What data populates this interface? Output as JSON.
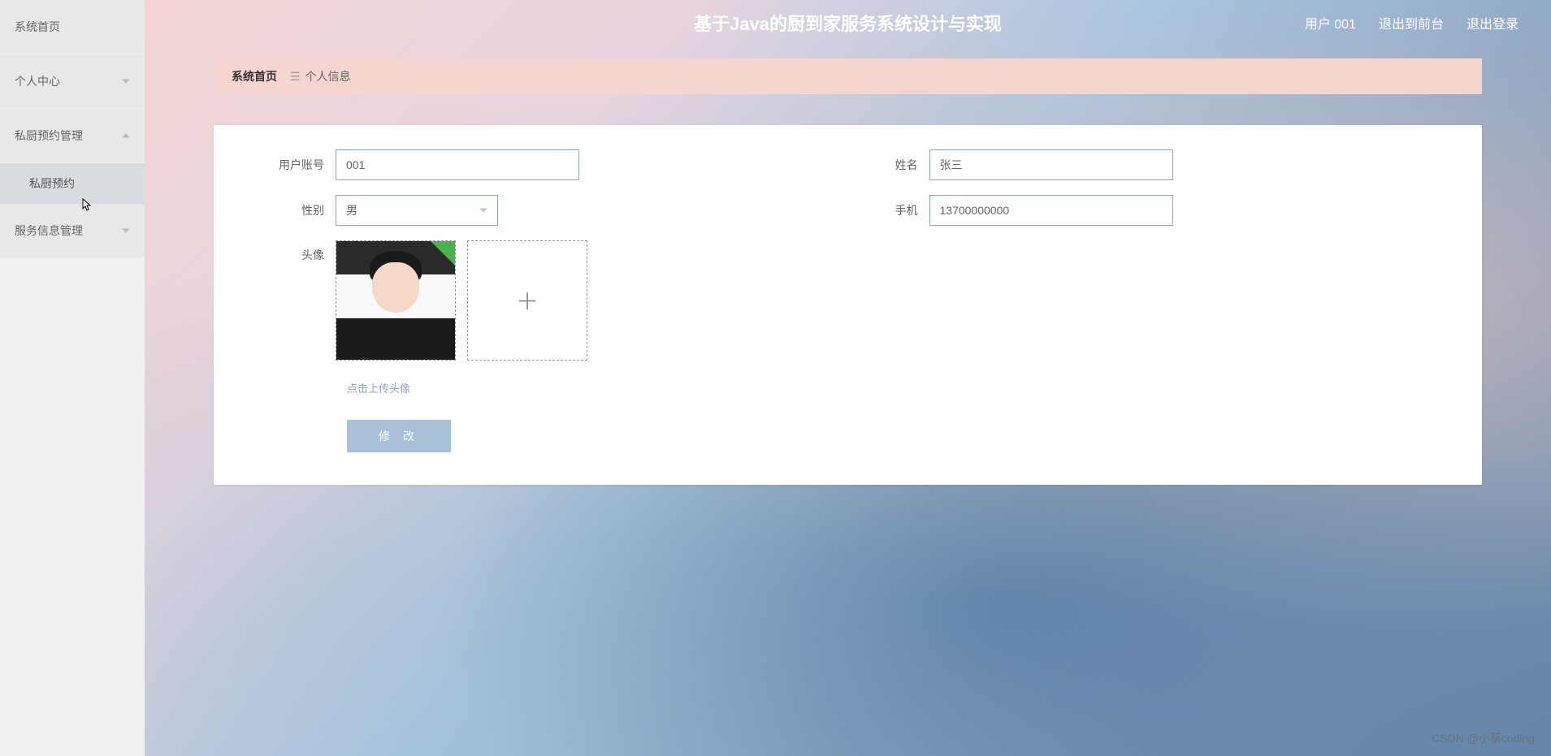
{
  "header": {
    "title": "基于Java的厨到家服务系统设计与实现",
    "links": {
      "user": "用户 001",
      "logout_front": "退出到前台",
      "logout": "退出登录"
    }
  },
  "sidebar": {
    "items": [
      {
        "label": "系统首页",
        "expandable": false
      },
      {
        "label": "个人中心",
        "expandable": true,
        "expanded": false
      },
      {
        "label": "私厨预约管理",
        "expandable": true,
        "expanded": true,
        "children": [
          {
            "label": "私厨预约"
          }
        ]
      },
      {
        "label": "服务信息管理",
        "expandable": true,
        "expanded": false
      }
    ]
  },
  "breadcrumb": {
    "home": "系统首页",
    "current": "个人信息"
  },
  "form": {
    "account": {
      "label": "用户账号",
      "value": "001"
    },
    "name": {
      "label": "姓名",
      "value": "张三"
    },
    "gender": {
      "label": "性别",
      "value": "男"
    },
    "phone": {
      "label": "手机",
      "value": "13700000000"
    },
    "avatar": {
      "label": "头像"
    },
    "upload_hint": "点击上传头像",
    "submit": "修 改"
  },
  "watermark": "CSDN @小蔡coding"
}
